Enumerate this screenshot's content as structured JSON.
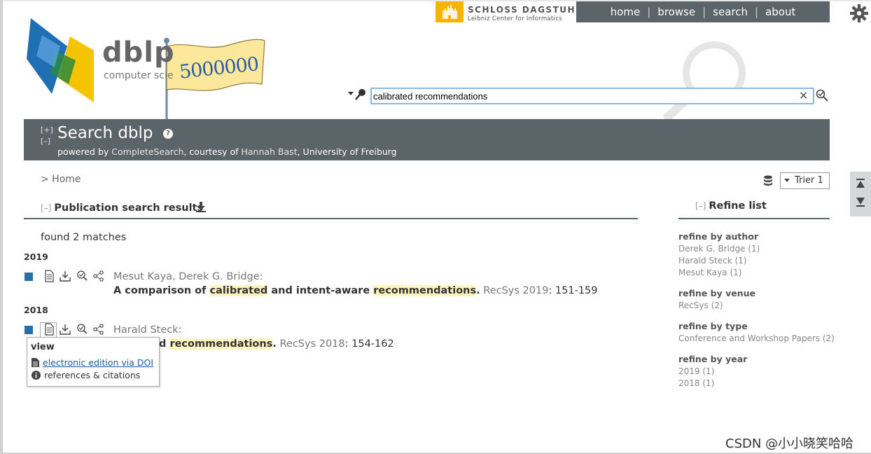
{
  "topnav": {
    "sponsor_line1": "SCHLOSS DAGSTUHL",
    "sponsor_line2": "Leibniz Center for Informatics",
    "links": [
      "home",
      "browse",
      "search",
      "about"
    ]
  },
  "logo": {
    "name": "dblp",
    "subtitle": "computer scie",
    "flag_text": "5000000"
  },
  "search": {
    "value": "calibrated recommendations"
  },
  "header": {
    "toggle_expand": "[+]",
    "toggle_collapse": "[–]",
    "title": "Search dblp",
    "help": "?",
    "powered_prefix": "powered by ",
    "powered_link1": "CompleteSearch",
    "powered_mid": ", courtesy of ",
    "powered_link2": "Hannah Bast",
    "powered_suffix": ", University of Freiburg"
  },
  "breadcrumb": "> Home",
  "mirror": {
    "selected": "Trier 1"
  },
  "results": {
    "section_toggle": "[–]",
    "section_title": "Publication search results",
    "found": "found 2 matches",
    "groups": [
      {
        "year": "2019",
        "entries": [
          {
            "authors": "Mesut Kaya, Derek G. Bridge:",
            "title_parts": [
              "A comparison of ",
              "calibrated",
              " and intent-aware ",
              "recommendations",
              "."
            ],
            "venue": " RecSys 2019",
            "pages": ": 151-159"
          }
        ]
      },
      {
        "year": "2018",
        "entries": [
          {
            "authors": "Harald Steck:",
            "title_parts": [
              "d ",
              "recommendations",
              "."
            ],
            "venue": " RecSys 2018",
            "pages": ": 154-162"
          }
        ]
      }
    ]
  },
  "popup": {
    "heading": "view",
    "link": "electronic edition via DOI",
    "item2": "references & citations"
  },
  "refine": {
    "toggle": "[–]",
    "title": "Refine list",
    "groups": [
      {
        "heading": "refine by author",
        "items": [
          "Derek G. Bridge (1)",
          "Harald Steck (1)",
          "Mesut Kaya (1)"
        ]
      },
      {
        "heading": "refine by venue",
        "items": [
          "RecSys (2)"
        ]
      },
      {
        "heading": "refine by type",
        "items": [
          "Conference and Workshop Papers (2)"
        ]
      },
      {
        "heading": "refine by year",
        "items": [
          "2019 (1)",
          "2018 (1)"
        ]
      }
    ]
  },
  "watermark": "CSDN @小小晓笑哈哈",
  "colors": {
    "header_band": "#5a6469",
    "accent_blue": "#2a6ea6",
    "highlight": "#fff3c0",
    "dagstuhl_yellow": "#f5b400"
  }
}
